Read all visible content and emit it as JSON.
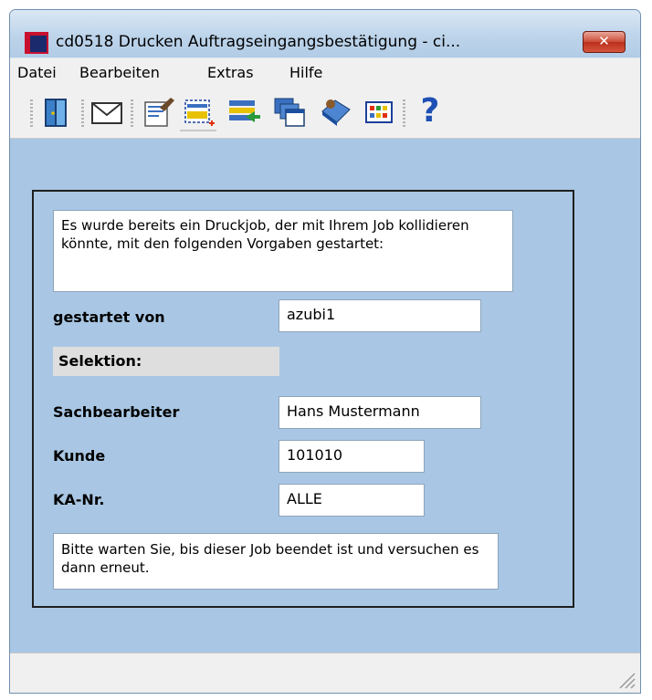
{
  "window": {
    "title": "cd0518 Drucken Auftragseingangsbestätigung - ci...",
    "close_glyph": "✕",
    "accent_color": "#a9c7e4"
  },
  "menu": [
    "Datei",
    "Bearbeiten",
    "Extras",
    "Hilfe"
  ],
  "toolbar": {
    "icons": [
      "exit-door-icon",
      "mail-envelope-icon",
      "edit-document-icon",
      "print-layout-icon",
      "list-import-icon",
      "windows-cascade-icon",
      "book-icon",
      "grid-table-icon",
      "help-icon"
    ],
    "help_glyph": "?"
  },
  "dialog": {
    "intro_text": "Es wurde bereits ein Druckjob, der mit Ihrem Job kollidieren könnte, mit den folgenden Vorgaben gestartet:",
    "started_by_label": "gestartet von",
    "started_by_value": "azubi1",
    "selection_label": "Selektion:",
    "clerk_label": "Sachbearbeiter",
    "clerk_value": "Hans Mustermann",
    "customer_label": "Kunde",
    "customer_value": "101010",
    "ka_label": "KA-Nr.",
    "ka_value": "ALLE",
    "outro_text": "Bitte warten Sie, bis dieser Job beendet ist und versuchen es dann erneut."
  }
}
